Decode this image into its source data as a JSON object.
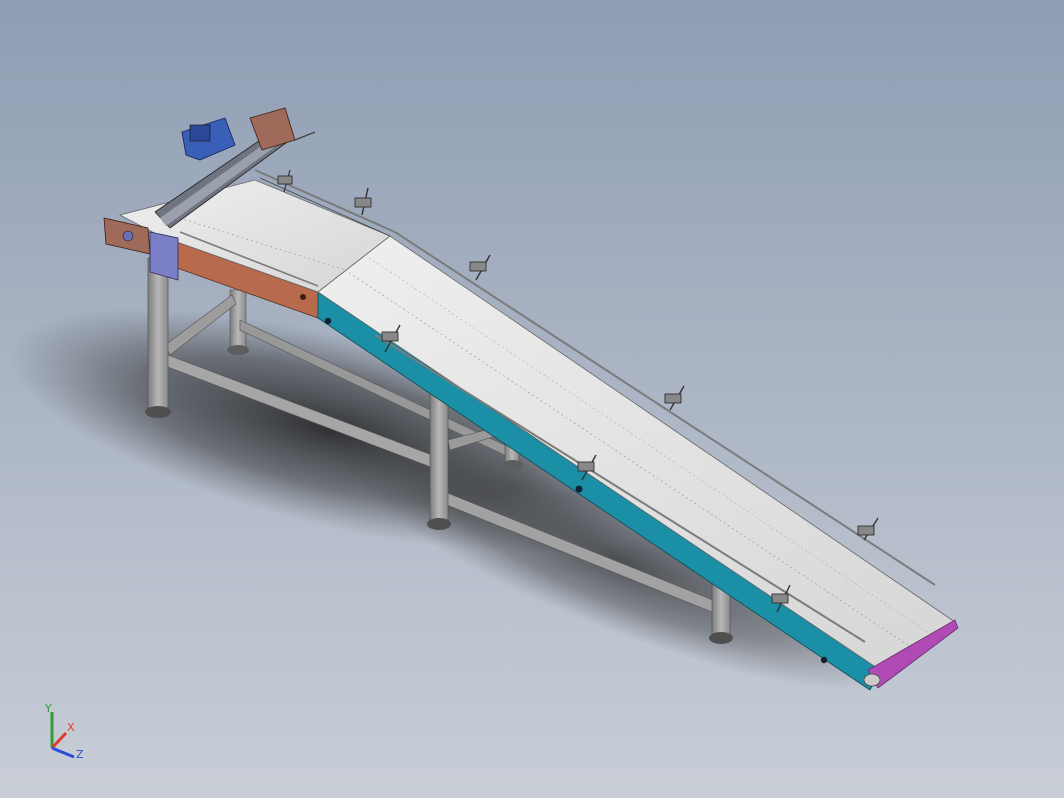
{
  "viewport": {
    "background_top": "#8f9db3",
    "background_bottom": "#c9ced7"
  },
  "colors": {
    "belt": "#e4e4e4",
    "belt_dark": "#c9c9c9",
    "side_teal": "#1b8fa6",
    "side_brown": "#b86a4c",
    "frame_steel": "#a8a8a8",
    "frame_dark": "#6e6e6e",
    "motor_blue": "#3a5fb8",
    "end_magenta": "#b04bb6"
  },
  "triad": {
    "x_label": "X",
    "y_label": "Y",
    "z_label": "Z",
    "x_color": "#e23a2a",
    "y_color": "#2e9c3a",
    "z_color": "#2a4fd8"
  }
}
